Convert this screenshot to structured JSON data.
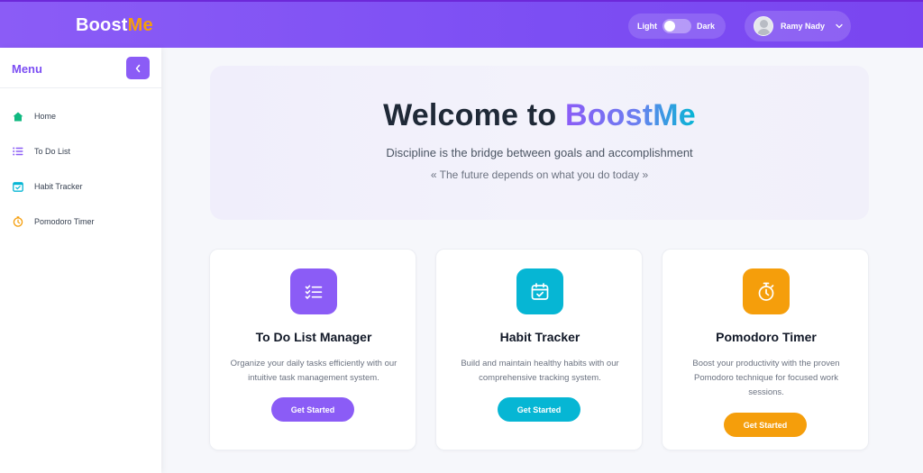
{
  "header": {
    "logo_part1": "Boost",
    "logo_part2": "Me",
    "theme_light_label": "Light",
    "theme_dark_label": "Dark",
    "user_name": "Ramy Nady",
    "chevron": "⌄"
  },
  "sidebar": {
    "menu_title": "Menu",
    "collapse_glyph": "‹",
    "items": [
      {
        "label": "Home",
        "icon": "home-icon",
        "color": "#10b981"
      },
      {
        "label": "To Do List",
        "icon": "list-icon",
        "color": "#8b5cf6"
      },
      {
        "label": "Habit Tracker",
        "icon": "calendar-check-icon",
        "color": "#06b6d4"
      },
      {
        "label": "Pomodoro Timer",
        "icon": "stopwatch-icon",
        "color": "#f59e0b"
      }
    ]
  },
  "hero": {
    "title_prefix": "Welcome to ",
    "title_brand": "BoostMe",
    "subtitle": "Discipline is the bridge between goals and accomplishment",
    "quote": "« The future depends on what you do today »"
  },
  "cards": [
    {
      "title": "To Do List Manager",
      "desc": "Organize your daily tasks efficiently with our intuitive task management system.",
      "button": "Get Started",
      "icon": "checklist-icon",
      "color": "#8b5cf6"
    },
    {
      "title": "Habit Tracker",
      "desc": "Build and maintain healthy habits with our comprehensive tracking system.",
      "button": "Get Started",
      "icon": "calendar-check-icon",
      "color": "#06b6d4"
    },
    {
      "title": "Pomodoro Timer",
      "desc": "Boost your productivity with the proven Pomodoro technique for focused work sessions.",
      "button": "Get Started",
      "icon": "stopwatch-icon",
      "color": "#f59e0b"
    }
  ],
  "colors": {
    "brand_purple": "#8b5cf6",
    "brand_orange": "#f59e0b",
    "brand_cyan": "#06b6d4",
    "brand_green": "#10b981"
  }
}
